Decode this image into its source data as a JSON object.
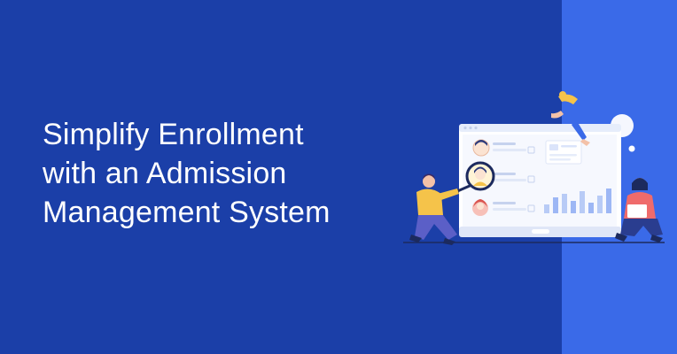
{
  "banner": {
    "headline_lines": [
      "Simplify Enrollment",
      "with an Admission",
      "Management System"
    ]
  },
  "colors": {
    "background": "#1b3fa8",
    "side_panel": "#3a6ae8",
    "headline_text": "#ffffff",
    "accent_yellow": "#f5c34a",
    "accent_pink": "#ef6b6b",
    "chart_bars": "#9db7f5"
  }
}
